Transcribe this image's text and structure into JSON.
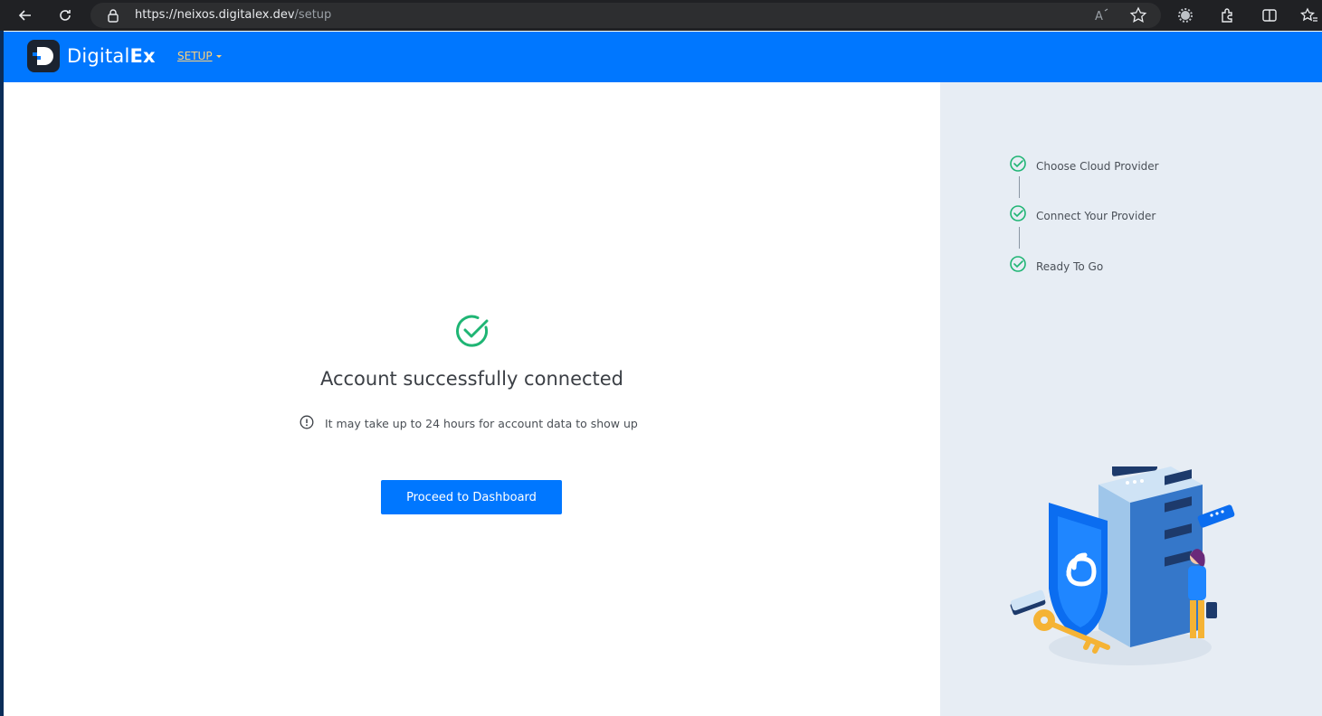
{
  "browser": {
    "url_host": "https://neixos.digitalex.dev",
    "url_path": "/setup"
  },
  "header": {
    "logo_text_regular": "Digital",
    "logo_text_bold": "Ex",
    "menu_label": "SETUP"
  },
  "main": {
    "title": "Account successfully connected",
    "info_text": "It may take up to 24 hours for account data to show up",
    "proceed_label": "Proceed to Dashboard"
  },
  "steps": [
    {
      "label": "Choose Cloud Provider",
      "status": "complete"
    },
    {
      "label": "Connect Your Provider",
      "status": "complete"
    },
    {
      "label": "Ready To Go",
      "status": "complete"
    }
  ],
  "colors": {
    "brand": "#0077ff",
    "success": "#1fb574",
    "panel_bg": "#e7edf4"
  },
  "icons": {
    "success": "check-circle-icon",
    "info": "info-circle-icon",
    "step": "check-circle-icon"
  }
}
